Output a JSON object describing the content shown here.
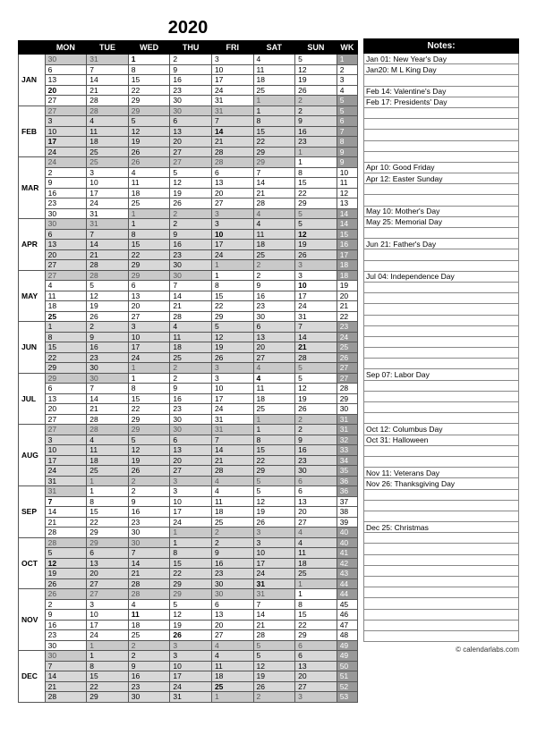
{
  "title": "2020",
  "footer": "© calendarlabs.com",
  "headers": [
    "MON",
    "TUE",
    "WED",
    "THU",
    "FRI",
    "SAT",
    "SUN",
    "WK"
  ],
  "months": [
    "JAN",
    "FEB",
    "MAR",
    "APR",
    "MAY",
    "JUN",
    "JUL",
    "AUG",
    "SEP",
    "OCT",
    "NOV",
    "DEC"
  ],
  "notes_label": "Notes:",
  "notes": [
    "Jan 01: New Year's Day",
    "Jan20: M L King Day",
    "",
    "Feb 14: Valentine's Day",
    "Feb 17: Presidents' Day",
    "",
    "",
    "",
    "",
    "",
    "Apr 10: Good Friday",
    "Apr 12: Easter Sunday",
    "",
    "",
    "May 10: Mother's Day",
    "May 25: Memorial Day",
    "",
    "Jun 21: Father's Day",
    "",
    "",
    "Jul 04: Independence Day",
    "",
    "",
    "",
    "",
    "",
    "",
    "",
    "",
    "Sep 07: Labor Day",
    "",
    "",
    "",
    "",
    "Oct 12: Columbus Day",
    "Oct 31: Halloween",
    "",
    "",
    "Nov 11: Veterans Day",
    "Nov 26: Thanksgiving Day",
    "",
    "",
    "",
    "Dec 25: Christmas",
    "",
    "",
    "",
    "",
    "",
    "",
    "",
    "",
    "",
    ""
  ],
  "holidays": {
    "0": [
      1,
      20
    ],
    "1": [
      14,
      17
    ],
    "3": [
      10,
      12
    ],
    "4": [
      10,
      25
    ],
    "5": [
      21
    ],
    "6": [
      4
    ],
    "8": [
      7
    ],
    "9": [
      12,
      31
    ],
    "10": [
      11,
      26
    ],
    "11": [
      25
    ]
  },
  "chart_data": {
    "type": "table",
    "title": "2020 Yearly Calendar (ISO weeks, Monday start)",
    "year": 2020,
    "week_start": "MON",
    "months": [
      {
        "name": "JAN",
        "first_weekday": "WED",
        "days": 31,
        "iso_weeks": [
          1,
          2,
          3,
          4,
          5
        ]
      },
      {
        "name": "FEB",
        "first_weekday": "SAT",
        "days": 29,
        "iso_weeks": [
          5,
          6,
          7,
          8,
          9
        ]
      },
      {
        "name": "MAR",
        "first_weekday": "SUN",
        "days": 31,
        "iso_weeks": [
          9,
          10,
          11,
          12,
          13,
          14
        ]
      },
      {
        "name": "APR",
        "first_weekday": "WED",
        "days": 30,
        "iso_weeks": [
          14,
          15,
          16,
          17,
          18
        ]
      },
      {
        "name": "MAY",
        "first_weekday": "FRI",
        "days": 31,
        "iso_weeks": [
          18,
          19,
          20,
          21,
          22
        ]
      },
      {
        "name": "JUN",
        "first_weekday": "MON",
        "days": 30,
        "iso_weeks": [
          23,
          24,
          25,
          26,
          27
        ]
      },
      {
        "name": "JUL",
        "first_weekday": "WED",
        "days": 31,
        "iso_weeks": [
          27,
          28,
          29,
          30,
          31
        ]
      },
      {
        "name": "AUG",
        "first_weekday": "SAT",
        "days": 31,
        "iso_weeks": [
          31,
          32,
          33,
          34,
          35,
          36
        ]
      },
      {
        "name": "SEP",
        "first_weekday": "TUE",
        "days": 30,
        "iso_weeks": [
          36,
          37,
          38,
          39,
          40
        ]
      },
      {
        "name": "OCT",
        "first_weekday": "THU",
        "days": 31,
        "iso_weeks": [
          40,
          41,
          42,
          43,
          44
        ]
      },
      {
        "name": "NOV",
        "first_weekday": "SUN",
        "days": 30,
        "iso_weeks": [
          44,
          45,
          46,
          47,
          48,
          49
        ]
      },
      {
        "name": "DEC",
        "first_weekday": "TUE",
        "days": 31,
        "iso_weeks": [
          49,
          50,
          51,
          52,
          53
        ]
      }
    ]
  }
}
